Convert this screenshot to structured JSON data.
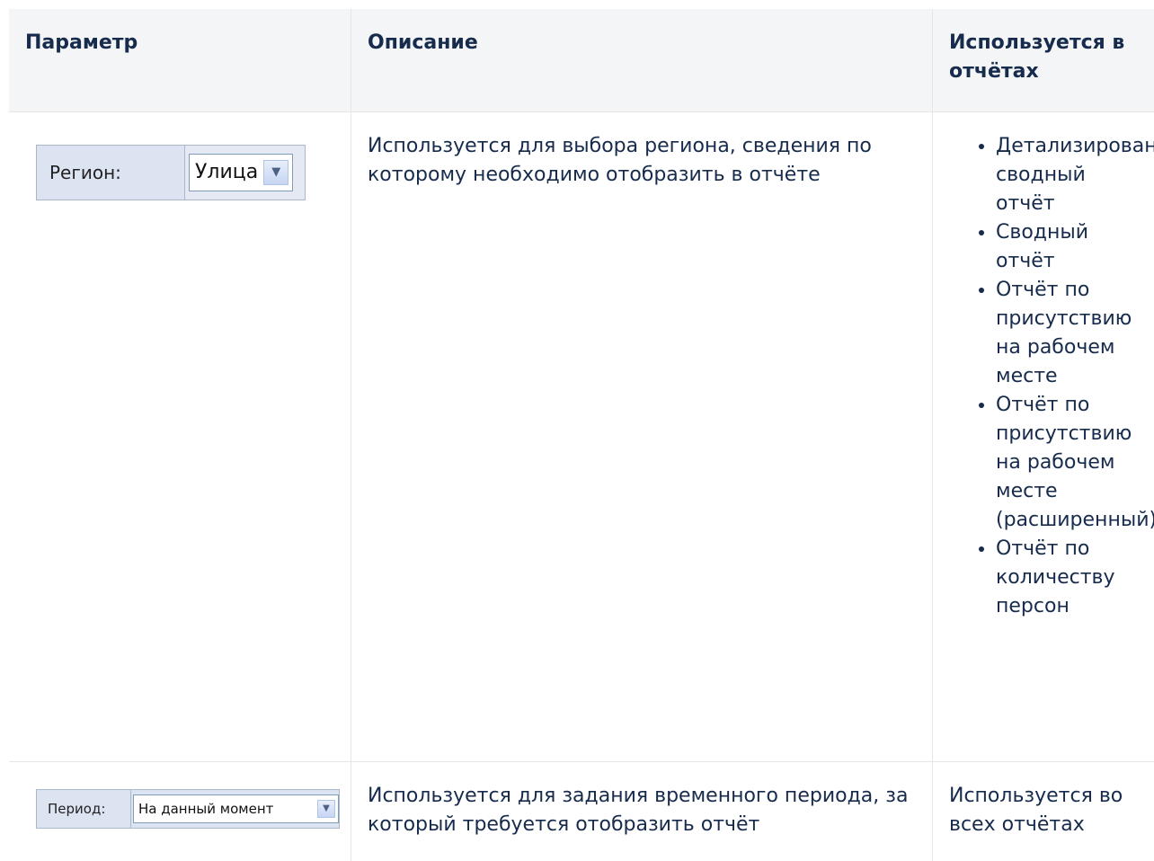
{
  "header": {
    "col1": "Параметр",
    "col2": "Описание",
    "col3": "Используется в отчётах"
  },
  "rows": [
    {
      "widget": {
        "label": "Регион:",
        "value": "Улица"
      },
      "description": "Используется для выбора региона, сведения по которому необходимо отобразить в отчёте",
      "used_in": [
        "Детализированный сводный отчёт",
        "Сводный отчёт",
        "Отчёт по присутствию на рабочем месте",
        "Отчёт по присутствию на рабочем месте (расширенный)",
        "Отчёт по количеству персон"
      ]
    },
    {
      "widget": {
        "label": "Период:",
        "value": "На данный момент"
      },
      "description": "Используется для задания временного периода, за который требуется отобразить отчёт",
      "used_in_text": "Используется во всех отчётах"
    }
  ]
}
